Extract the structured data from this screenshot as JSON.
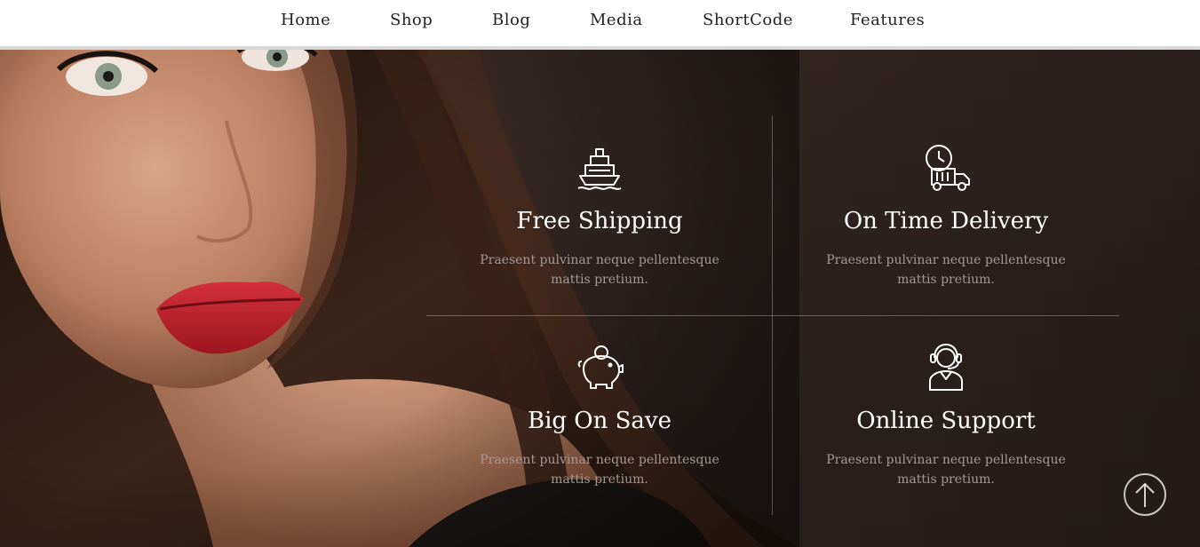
{
  "nav": {
    "items": [
      "Home",
      "Shop",
      "Blog",
      "Media",
      "ShortCode",
      "Features"
    ]
  },
  "features": [
    {
      "icon": "ship-icon",
      "title": "Free Shipping",
      "desc_line1": "Praesent pulvinar neque pellentesque",
      "desc_line2": "mattis pretium."
    },
    {
      "icon": "delivery-truck-clock-icon",
      "title": "On Time Delivery",
      "desc_line1": "Praesent pulvinar neque pellentesque",
      "desc_line2": "mattis pretium."
    },
    {
      "icon": "piggy-bank-icon",
      "title": "Big On Save",
      "desc_line1": "Praesent pulvinar neque pellentesque",
      "desc_line2": "mattis pretium."
    },
    {
      "icon": "headset-support-icon",
      "title": "Online Support",
      "desc_line1": "Praesent pulvinar neque pellentesque",
      "desc_line2": "mattis pretium."
    }
  ],
  "colors": {
    "nav_bg": "#ffffff",
    "nav_text": "#222222",
    "hero_bg": "#2e2420",
    "feature_title": "#ffffff",
    "feature_desc": "#a39893",
    "lips": "#c4202a"
  },
  "scroll_top": {
    "icon": "arrow-up-circle-icon"
  }
}
